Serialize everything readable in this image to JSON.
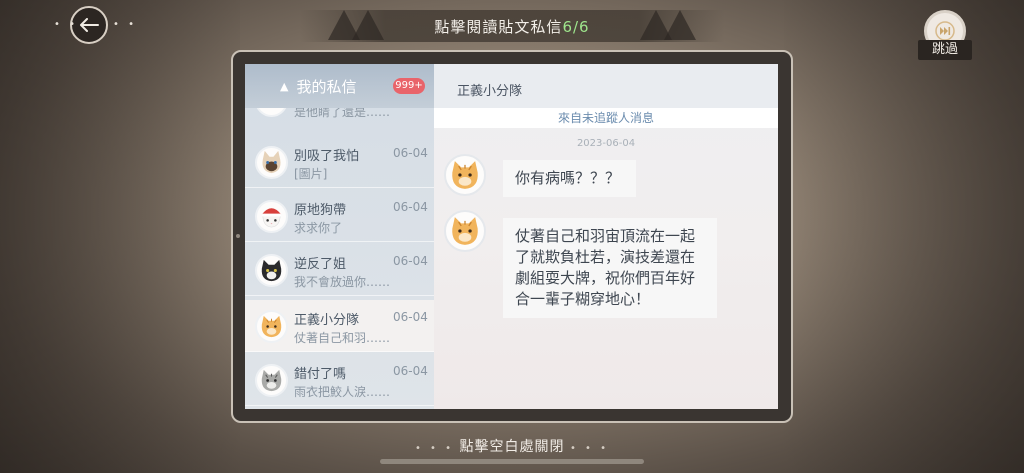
{
  "header": {
    "title": "點擊閱讀貼文私信",
    "progress": "6/6",
    "skip_label": "跳過"
  },
  "inbox": {
    "title": "我的私信",
    "badge": "999+",
    "partial_preview": "是他睛了還是……",
    "contacts": [
      {
        "name": "別吸了我怕",
        "date": "06-04",
        "preview": "[圖片]",
        "avatar": "siamese-cat-avatar"
      },
      {
        "name": "原地狗帶",
        "date": "06-04",
        "preview": "求求你了",
        "avatar": "white-cat-santa-hat-avatar"
      },
      {
        "name": "逆反了姐",
        "date": "06-04",
        "preview": "我不會放過你……",
        "avatar": "black-cat-avatar"
      },
      {
        "name": "正義小分隊",
        "date": "06-04",
        "preview": "仗著自己和羽……",
        "avatar": "orange-cat-avatar",
        "active": true
      },
      {
        "name": "錯付了嗎",
        "date": "06-04",
        "preview": "雨衣把鮫人淚……",
        "avatar": "gray-tabby-cat-avatar"
      }
    ]
  },
  "chat": {
    "contact_name": "正義小分隊",
    "stranger_notice": "來自未追蹤人消息",
    "date": "2023-06-04",
    "messages": [
      {
        "text": "你有病嗎？？？"
      },
      {
        "text": "仗著自己和羽宙頂流在一起了就欺負杜若，演技差還在劇組耍大牌，祝你們百年好合一輩子糊穿地心！"
      }
    ]
  },
  "footer": {
    "close_hint": "點擊空白處關閉"
  },
  "colors": {
    "badge": "#e9646a",
    "progress": "#9ee58c",
    "accent_blue": "#6b8cae"
  }
}
